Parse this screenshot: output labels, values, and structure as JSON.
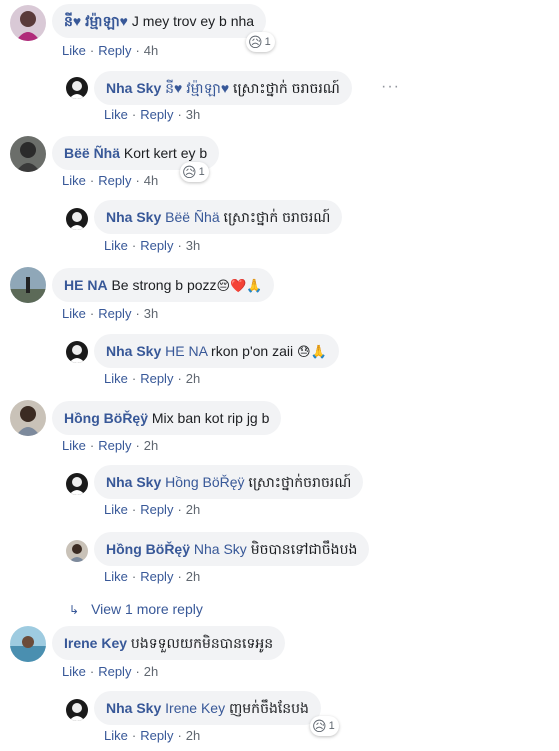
{
  "comments": [
    {
      "author": "នី♥ វម្ម៉ាឡា♥",
      "text": " J mey trov ey b nha",
      "like": "Like",
      "reply": "Reply",
      "time": "4h",
      "reaction": {
        "emoji": "😥",
        "count": "1"
      }
    },
    {
      "author": "Nha Sky",
      "mention": "នី♥ វម្ម៉ាឡា♥",
      "text": " ស្រោះថ្នាក់ ចរាចរណ៍",
      "like": "Like",
      "reply": "Reply",
      "time": "3h",
      "more": "···"
    },
    {
      "author": "Bëë Ñhä",
      "text": " Kort kert ey b",
      "like": "Like",
      "reply": "Reply",
      "time": "4h",
      "reaction": {
        "emoji": "😥",
        "count": "1"
      }
    },
    {
      "author": "Nha Sky",
      "mention": "Bëë Ñhä",
      "text": " ស្រោះថ្នាក់ ចរាចរណ៍",
      "like": "Like",
      "reply": "Reply",
      "time": "3h"
    },
    {
      "author": "HE NA",
      "text": " Be strong b pozz",
      "emojis": "😔❤️🙏",
      "like": "Like",
      "reply": "Reply",
      "time": "3h"
    },
    {
      "author": "Nha Sky",
      "mention": "HE NA",
      "text": " rkon p'on zaii ",
      "emojis": "😓🙏",
      "like": "Like",
      "reply": "Reply",
      "time": "2h"
    },
    {
      "author": "Hồng BöŘęÿ",
      "text": " Mix ban kot rip jg b",
      "like": "Like",
      "reply": "Reply",
      "time": "2h"
    },
    {
      "author": "Nha Sky",
      "mention": "Hồng BöŘęÿ",
      "text": " ស្រោះថ្នាក់ចរាចរណ៍",
      "like": "Like",
      "reply": "Reply",
      "time": "2h"
    },
    {
      "author": "Hồng BöŘęÿ",
      "mention": "Nha Sky",
      "text": " មិចបានទៅជាចឹងបង",
      "like": "Like",
      "reply": "Reply",
      "time": "2h"
    },
    {
      "author": "Irene Key",
      "text": " បងទទួលយកមិនបានទេអូន",
      "like": "Like",
      "reply": "Reply",
      "time": "2h"
    },
    {
      "author": "Nha Sky",
      "mention": "Irene Key",
      "text": " ញមក់ចឹងនែបង",
      "like": "Like",
      "reply": "Reply",
      "time": "2h",
      "reaction": {
        "emoji": "😥",
        "count": "1"
      }
    }
  ],
  "view_more": {
    "arrow": "↳",
    "label": "View 1 more reply"
  },
  "separator": "·",
  "colors": {
    "link": "#385898",
    "bubble": "#f2f3f5",
    "meta": "#606770"
  }
}
